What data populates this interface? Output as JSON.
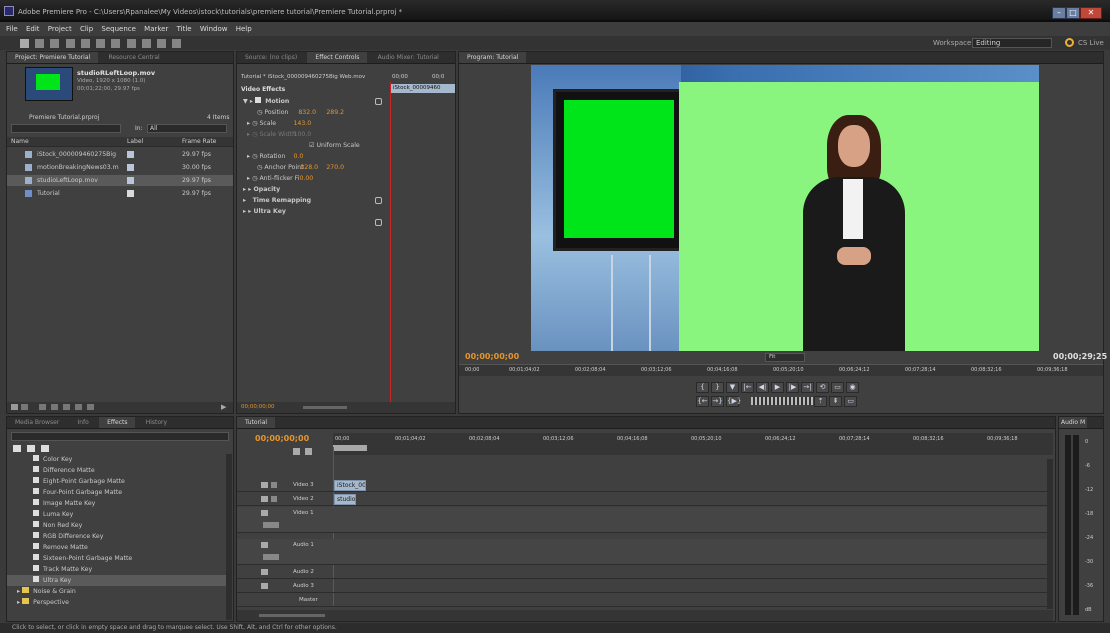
{
  "window": {
    "title": "Adobe Premiere Pro - C:\\Users\\Rpanalee\\My Videos\\istock\\tutorials\\premiere tutorial\\Premiere Tutorial.prproj *"
  },
  "menu": [
    "File",
    "Edit",
    "Project",
    "Clip",
    "Sequence",
    "Marker",
    "Title",
    "Window",
    "Help"
  ],
  "workspace": {
    "label": "Workspace:",
    "value": "Editing",
    "cs_live": "CS Live"
  },
  "project_panel": {
    "tabs": [
      "Project: Premiere Tutorial",
      "Resource Central"
    ],
    "clip_name": "studioRLeftLoop.mov",
    "clip_info1": "Video, 1920 x 1080 (1.0)",
    "clip_info2": "00;01;22;00, 29.97 fps",
    "project_file": "Premiere Tutorial.prproj",
    "items_count": "4 Items",
    "in_label": "In:",
    "in_value": "All",
    "columns": [
      "Name",
      "Label",
      "Frame Rate"
    ],
    "rows": [
      {
        "name": "iStock_000009460275Big",
        "rate": "29.97 fps"
      },
      {
        "name": "motionBreakingNews03.m",
        "rate": "30.00 fps"
      },
      {
        "name": "studioLeftLoop.mov",
        "rate": "29.97 fps"
      },
      {
        "name": "Tutorial",
        "rate": "29.97 fps"
      }
    ]
  },
  "effect_controls": {
    "tabs": [
      "Source: (no clips)",
      "Effect Controls",
      "Audio Mixer: Tutorial"
    ],
    "header": "Tutorial * iStock_000009460275Big Web.mov",
    "tc_start": "00;00",
    "tc_end": "00;0",
    "clip_label": "iStock_00009460",
    "section": "Video Effects",
    "motion": "Motion",
    "position_label": "Position",
    "position_x": "832.0",
    "position_y": "289.2",
    "scale_label": "Scale",
    "scale_value": "143.0",
    "scale_width_label": "Scale Width",
    "scale_width_value": "100.0",
    "uniform_scale": "Uniform Scale",
    "rotation_label": "Rotation",
    "rotation_value": "0.0",
    "anchor_label": "Anchor Point",
    "anchor_x": "328.0",
    "anchor_y": "270.0",
    "antiflicker_label": "Anti-flicker Filter",
    "antiflicker_value": "0.00",
    "opacity": "Opacity",
    "time_remap": "Time Remapping",
    "ultra_key": "Ultra Key",
    "bottom_tc": "00;00;00;00"
  },
  "program_monitor": {
    "tab": "Program: Tutorial",
    "timecode_left": "00;00;00;00",
    "fit": "Fit",
    "timecode_right": "00;00;29;25",
    "ruler": [
      "00;00",
      "00;01;04;02",
      "00;02;08;04",
      "00;03;12;06",
      "00;04;16;08",
      "00;05;20;10",
      "00;06;24;12",
      "00;07;28;14",
      "00;08;32;16",
      "00;09;36;18"
    ]
  },
  "effects_panel": {
    "tabs": [
      "Media Browser",
      "Info",
      "Effects",
      "History"
    ],
    "items": [
      "Color Key",
      "Difference Matte",
      "Eight-Point Garbage Matte",
      "Four-Point Garbage Matte",
      "Image Matte Key",
      "Luma Key",
      "Non Red Key",
      "RGB Difference Key",
      "Remove Matte",
      "Sixteen-Point Garbage Matte",
      "Track Matte Key",
      "Ultra Key"
    ],
    "folders": [
      "Noise & Grain",
      "Perspective"
    ]
  },
  "timeline": {
    "tab": "Tutorial",
    "timecode": "00;00;00;00",
    "ruler": [
      "00;00",
      "00;01;04;02",
      "00;02;08;04",
      "00;03;12;06",
      "00;04;16;08",
      "00;05;20;10",
      "00;06;24;12",
      "00;07;28;14",
      "00;08;32;16",
      "00;09;36;18"
    ],
    "tracks": [
      "Video 3",
      "Video 2",
      "Video 1",
      "Audio 1",
      "Audio 2",
      "Audio 3",
      "Master"
    ],
    "clip_v3": "iStock_000",
    "clip_v2": "studio"
  },
  "audio_meter": {
    "tab": "Audio M",
    "levels": [
      "0",
      "-6",
      "-12",
      "-18",
      "-24",
      "-30",
      "-36",
      "dB"
    ]
  },
  "status": "Click to select, or click in empty space and drag to marquee select. Use Shift, Alt, and Ctrl for other options."
}
